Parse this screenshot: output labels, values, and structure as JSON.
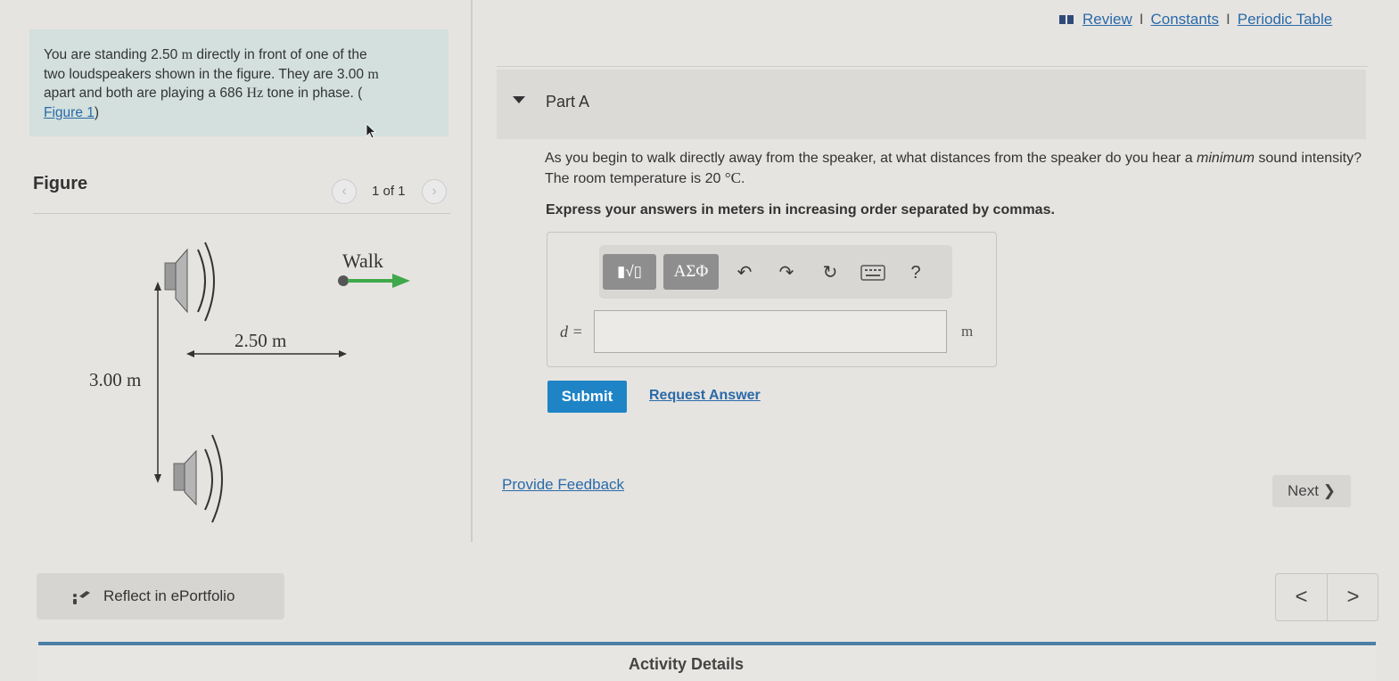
{
  "top_links": {
    "review": "Review",
    "constants": "Constants",
    "periodic_table": "Periodic Table",
    "separator": "I"
  },
  "intro": {
    "line1_a": "You are standing 2.50 ",
    "line1_unit": "m",
    "line1_b": " directly in front of one of the",
    "line2_a": "two loudspeakers shown in the figure. They are 3.00 ",
    "line2_unit": "m",
    "line3_a": "apart and both are playing a 686 ",
    "line3_unit": "Hz",
    "line3_b": " tone in phase. (",
    "figure_link": "Figure 1",
    "line4_b": ")"
  },
  "figure": {
    "title": "Figure",
    "pager_text": "1 of 1",
    "prev_icon": "chevron-left-icon",
    "next_icon": "chevron-right-icon",
    "diagram": {
      "walk_label": "Walk",
      "horizontal_label": "2.50 m",
      "vertical_label": "3.00 m",
      "arrow_color": "#3fa84a"
    }
  },
  "part_a": {
    "title": "Part A",
    "question_a": "As you begin to walk directly away from the speaker, at what distances from the speaker do you hear a ",
    "question_em": "minimum",
    "question_b": " sound intensity? The room temperature is 20 ",
    "question_unit": "°C",
    "question_end": ".",
    "instruction": "Express your answers in meters in increasing order separated by commas.",
    "toolbar": {
      "template_button": "▮√▯",
      "symbols_button": "ΑΣΦ",
      "undo_icon": "undo-icon",
      "redo_icon": "redo-icon",
      "reset_icon": "reset-icon",
      "keyboard_icon": "keyboard-icon",
      "help_label": "?"
    },
    "variable_label": "d =",
    "answer_value": "",
    "answer_unit": "m",
    "submit_label": "Submit",
    "request_answer_label": "Request Answer"
  },
  "footer": {
    "provide_feedback": "Provide Feedback",
    "next_label": "Next ❯",
    "reflect_label": "Reflect in ePortfolio",
    "prev_page": "<",
    "next_page": ">",
    "activity_details": "Activity Details"
  },
  "colors": {
    "accent_blue": "#1e84c6",
    "link_blue": "#2a6aa8",
    "intro_background": "#d3e0dd"
  }
}
